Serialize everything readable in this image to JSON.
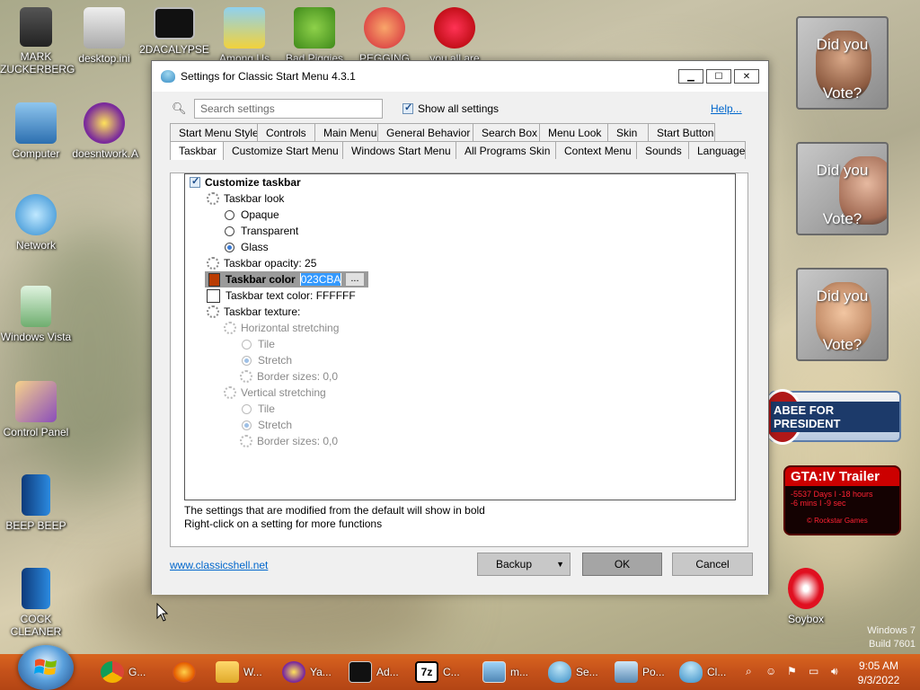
{
  "desktop": {
    "icons": [
      {
        "label": "MARK ZUCKERBERG",
        "icon": "person-icon"
      },
      {
        "label": "desktop.ini",
        "icon": "file-icon"
      },
      {
        "label": "2DACALYPSE",
        "icon": "console-icon"
      },
      {
        "label": "Among Us",
        "icon": "game-icon"
      },
      {
        "label": "Bad Piggies",
        "icon": "pig-icon"
      },
      {
        "label": "PEGGING",
        "icon": "p-icon"
      },
      {
        "label": "you all are",
        "icon": "devcpp-icon"
      },
      {
        "label": "Computer",
        "icon": "computer-icon"
      },
      {
        "label": "doesntwork...",
        "icon": "yahoo-icon"
      },
      {
        "label": "A",
        "icon": "app-icon"
      },
      {
        "label": "Network",
        "icon": "network-icon"
      },
      {
        "label": "Windows Vista",
        "icon": "recycle-bin-icon"
      },
      {
        "label": "Control Panel",
        "icon": "control-panel-icon"
      },
      {
        "label": "BEEP BEEP",
        "icon": "book-icon"
      },
      {
        "label": "COCK CLEANER",
        "icon": "book-icon"
      },
      {
        "label": "Soybox",
        "icon": "soybox-icon"
      }
    ],
    "gadgets": {
      "vote1": {
        "line1": "Did you",
        "line2": "Vote?"
      },
      "vote2": {
        "line1": "Did you",
        "line2": "Vote?"
      },
      "vote3": {
        "line1": "Did you",
        "line2": "Vote?"
      },
      "huckabee": "ABEE FOR PRESIDENT",
      "gta": {
        "title": "GTA:IV Trailer",
        "line1": "-5537 Days I -18 hours",
        "line2": "-6 mins I -9 sec",
        "footer": "© Rockstar Games"
      }
    },
    "watermark": {
      "line1": "Windows 7",
      "line2": "Build 7601"
    }
  },
  "window": {
    "title": "Settings for Classic Start Menu 4.3.1",
    "search_placeholder": "Search settings",
    "show_all_label": "Show all settings",
    "show_all_checked": true,
    "help_label": "Help...",
    "tabs_row1": [
      "Start Menu Style",
      "Controls",
      "Main Menu",
      "General Behavior",
      "Search Box",
      "Menu Look",
      "Skin",
      "Start Button"
    ],
    "tabs_row2": [
      "Taskbar",
      "Customize Start Menu",
      "Windows Start Menu",
      "All Programs Skin",
      "Context Menu",
      "Sounds",
      "Language"
    ],
    "active_tab": "Taskbar",
    "tree": {
      "customize_taskbar": "Customize taskbar",
      "taskbar_look": "Taskbar look",
      "opaque": "Opaque",
      "transparent": "Transparent",
      "glass": "Glass",
      "opacity": "Taskbar opacity: 25",
      "color_label": "Taskbar color",
      "color_value": "023CBA",
      "color_button": "...",
      "text_color": "Taskbar text color: FFFFFF",
      "texture": "Taskbar texture:",
      "h_stretch": "Horizontal stretching",
      "h_tile": "Tile",
      "h_stretch_opt": "Stretch",
      "h_border": "Border sizes: 0,0",
      "v_stretch": "Vertical stretching",
      "v_tile": "Tile",
      "v_stretch_opt": "Stretch",
      "v_border": "Border sizes: 0,0"
    },
    "info_line1": "The settings that are modified from the default will show in bold",
    "info_line2": "Right-click on a setting for more functions",
    "link": "www.classicshell.net",
    "backup_label": "Backup",
    "ok_label": "OK",
    "cancel_label": "Cancel",
    "colors": {
      "taskbar_color_swatch": "#BA3C02",
      "text_color_swatch": "#FFFFFF"
    }
  },
  "taskbar": {
    "items": [
      {
        "label": "G...",
        "icon": "chrome-icon"
      },
      {
        "label": "",
        "icon": "firefox-icon"
      },
      {
        "label": "W...",
        "icon": "explorer-icon"
      },
      {
        "label": "Ya...",
        "icon": "yahoo-icon"
      },
      {
        "label": "Ad...",
        "icon": "console-icon"
      },
      {
        "label": "C...",
        "icon": "7zip-icon"
      },
      {
        "label": "m...",
        "icon": "image-icon"
      },
      {
        "label": "Se...",
        "icon": "classic-shell-icon"
      },
      {
        "label": "Po...",
        "icon": "computer-icon"
      },
      {
        "label": "Cl...",
        "icon": "classic-shell-icon"
      }
    ],
    "time": "9:05 AM",
    "date": "9/3/2022"
  }
}
